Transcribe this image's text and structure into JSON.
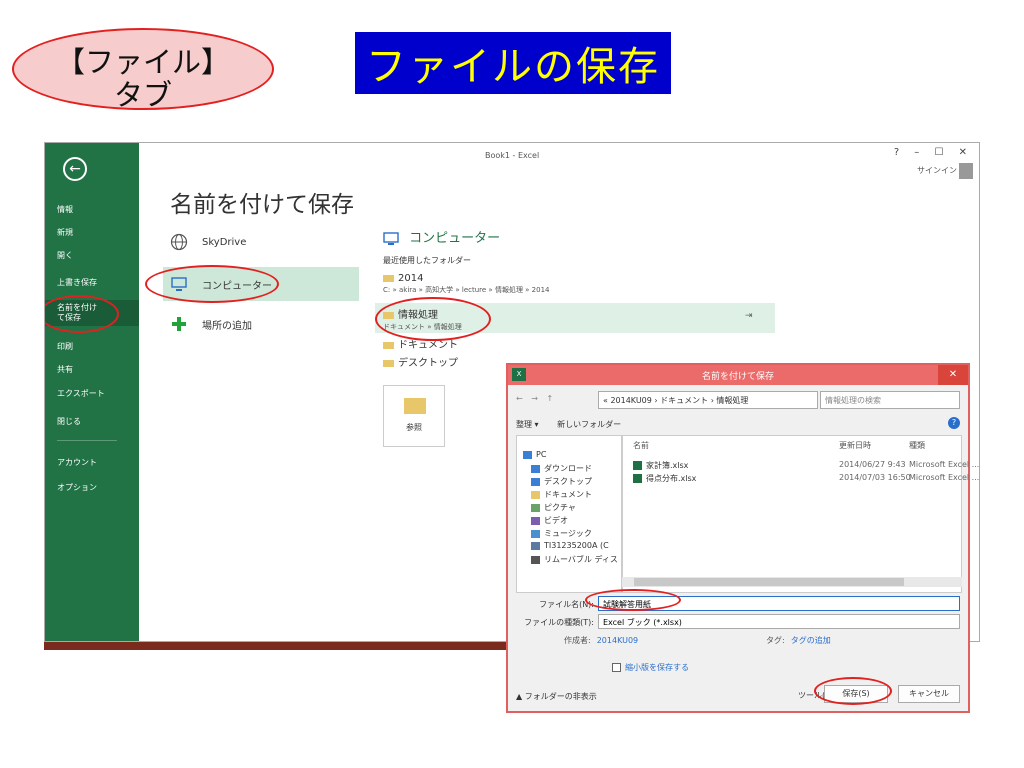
{
  "annotation": {
    "tab_line1": "【ファイル】",
    "tab_line2": "タブ",
    "title": "ファイルの保存"
  },
  "excel": {
    "window_title": "Book1 - Excel",
    "window_controls": "? – ☐ ✕",
    "signin": "サインイン",
    "back_icon": "←",
    "sidebar": [
      "情報",
      "新規",
      "開く",
      "上書き保存",
      "名前を付けて保存",
      "印刷",
      "共有",
      "エクスポート",
      "閉じる",
      "アカウント",
      "オプション"
    ],
    "heading": "名前を付けて保存",
    "places": [
      "SkyDrive",
      "コンピューター",
      "場所の追加"
    ],
    "right_heading": "コンピューター",
    "recent_label": "最近使用したフォルダー",
    "folders": [
      {
        "name": "2014",
        "path": "C: » akira » 高知大学 » lecture » 情報処理 » 2014"
      },
      {
        "name": "情報処理",
        "path": "ドキュメント » 情報処理"
      },
      {
        "name": "ドキュメント",
        "path": ""
      },
      {
        "name": "デスクトップ",
        "path": ""
      }
    ],
    "browse_label": "参照"
  },
  "dialog": {
    "title": "名前を付けて保存",
    "close": "✕",
    "nav_arrows": "← → ↑",
    "address": "« 2014KU09 › ドキュメント › 情報処理",
    "search_placeholder": "情報処理の検索",
    "organize": "整理 ▾",
    "new_folder": "新しいフォルダー",
    "help": "?",
    "nav_items": [
      "PC",
      "ダウンロード",
      "デスクトップ",
      "ドキュメント",
      "ピクチャ",
      "ビデオ",
      "ミュージック",
      "TI31235200A (C",
      "リムーバブル ディス"
    ],
    "columns": {
      "name": "名前",
      "date": "更新日時",
      "type": "種類"
    },
    "files": [
      {
        "name": "家計簿.xlsx",
        "date": "2014/06/27 9:43",
        "type": "Microsoft Excel ..."
      },
      {
        "name": "得点分布.xlsx",
        "date": "2014/07/03 16:50",
        "type": "Microsoft Excel ..."
      }
    ],
    "filename_label": "ファイル名(N):",
    "filename_value": "試験解答用紙",
    "filetype_label": "ファイルの種類(T):",
    "filetype_value": "Excel ブック (*.xlsx)",
    "author_label": "作成者:",
    "author_value": "2014KU09",
    "tag_label": "タグ:",
    "tag_value": "タグの追加",
    "thumbnail_label": "縮小版を保存する",
    "hide_folders": "フォルダーの非表示",
    "tools": "ツール(L) ▾",
    "save": "保存(S)",
    "cancel": "キャンセル"
  },
  "colors": {
    "excel_green": "#217346",
    "highlight_red": "#e32020",
    "title_blue": "#0000cc",
    "title_yellow": "#ffff00"
  }
}
